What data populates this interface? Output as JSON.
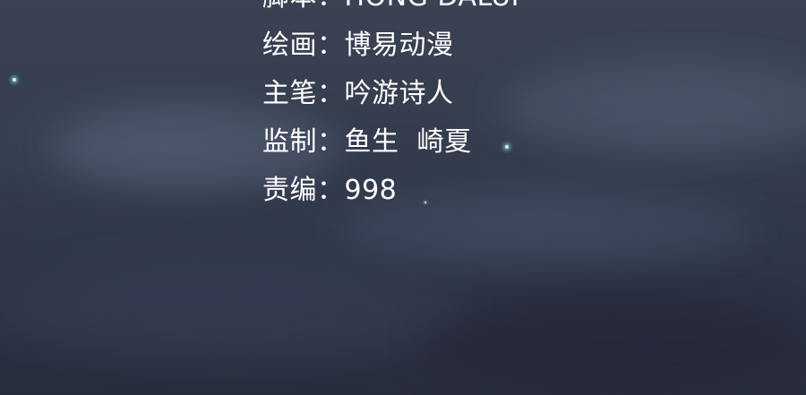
{
  "credits": [
    {
      "label": "脚本",
      "separator": "：",
      "value": "HONG DALUI"
    },
    {
      "label": "绘画",
      "separator": "：",
      "value": "博易动漫"
    },
    {
      "label": "主笔",
      "separator": "：",
      "value": "吟游诗人"
    },
    {
      "label": "监制",
      "separator": "：",
      "value": "鱼生  崎夏"
    },
    {
      "label": "责编",
      "separator": "：",
      "value": "998"
    }
  ],
  "colors": {
    "sky": "#343c4e",
    "text": "#ffffff",
    "star": "#bff5ef"
  }
}
